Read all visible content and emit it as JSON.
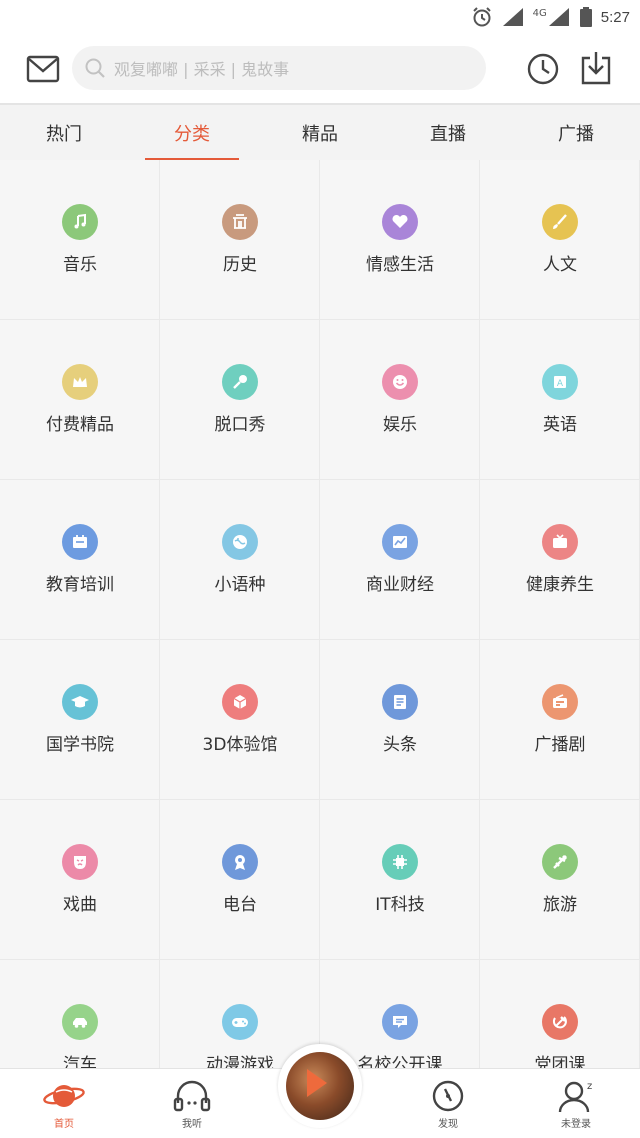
{
  "status_bar": {
    "time": "5:27",
    "network": "4G"
  },
  "header": {
    "search_placeholder": "观复嘟嘟 | 采采 | 鬼故事"
  },
  "tabs": [
    {
      "label": "热门"
    },
    {
      "label": "分类"
    },
    {
      "label": "精品"
    },
    {
      "label": "直播"
    },
    {
      "label": "广播"
    }
  ],
  "active_tab": "分类",
  "categories": [
    {
      "label": "音乐",
      "icon": "music-icon",
      "color": "#8cc87a"
    },
    {
      "label": "历史",
      "icon": "history-building-icon",
      "color": "#c89a7e"
    },
    {
      "label": "情感生活",
      "icon": "heart-icon",
      "color": "#a985d8"
    },
    {
      "label": "人文",
      "icon": "brush-icon",
      "color": "#e6c352"
    },
    {
      "label": "付费精品",
      "icon": "crown-icon",
      "color": "#e6cf7c"
    },
    {
      "label": "脱口秀",
      "icon": "microphone-icon",
      "color": "#6fcfbf"
    },
    {
      "label": "娱乐",
      "icon": "smile-icon",
      "color": "#ec8fae"
    },
    {
      "label": "英语",
      "icon": "letter-a-icon",
      "color": "#7fd5dc"
    },
    {
      "label": "教育培训",
      "icon": "education-icon",
      "color": "#6d9be0"
    },
    {
      "label": "小语种",
      "icon": "globe-icon",
      "color": "#84c7e4"
    },
    {
      "label": "商业财经",
      "icon": "chart-icon",
      "color": "#7aa3e2"
    },
    {
      "label": "健康养生",
      "icon": "tv-icon",
      "color": "#ec8585"
    },
    {
      "label": "国学书院",
      "icon": "graduation-cap-icon",
      "color": "#66c2d6"
    },
    {
      "label": "3D体验馆",
      "icon": "cube-icon",
      "color": "#ee7d7d"
    },
    {
      "label": "头条",
      "icon": "news-icon",
      "color": "#6f98da"
    },
    {
      "label": "广播剧",
      "icon": "radio-icon",
      "color": "#ec9670"
    },
    {
      "label": "戏曲",
      "icon": "opera-mask-icon",
      "color": "#ec8aa8"
    },
    {
      "label": "电台",
      "icon": "radio-station-icon",
      "color": "#6f98da"
    },
    {
      "label": "IT科技",
      "icon": "chip-icon",
      "color": "#66cdb8"
    },
    {
      "label": "旅游",
      "icon": "airplane-icon",
      "color": "#8cc87a"
    },
    {
      "label": "汽车",
      "icon": "car-icon",
      "color": "#96d38a"
    },
    {
      "label": "动漫游戏",
      "icon": "gamepad-icon",
      "color": "#7fc9e6"
    },
    {
      "label": "名校公开课",
      "icon": "chat-icon",
      "color": "#7aa3e2"
    },
    {
      "label": "党团课",
      "icon": "hammer-sickle-icon",
      "color": "#e87766"
    }
  ],
  "bottom_nav": [
    {
      "label": "首页",
      "icon": "planet-icon"
    },
    {
      "label": "我听",
      "icon": "headphones-icon"
    },
    {
      "label": "发现",
      "icon": "compass-icon"
    },
    {
      "label": "未登录",
      "icon": "user-icon"
    }
  ],
  "colors": {
    "accent": "#e45a39"
  }
}
